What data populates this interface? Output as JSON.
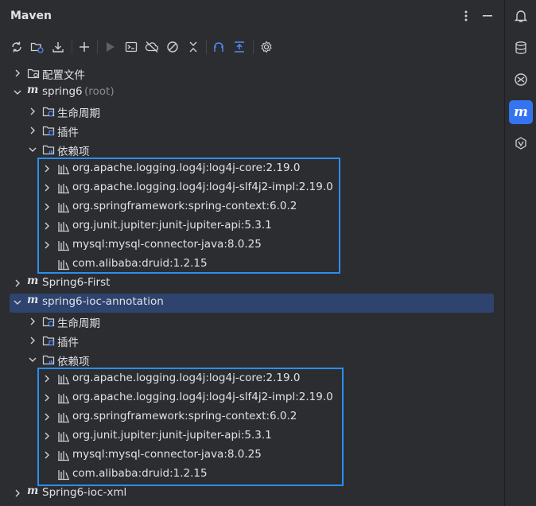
{
  "panel": {
    "title": "Maven"
  },
  "tree": {
    "config_files": "配置文件",
    "spring6": {
      "name": "spring6",
      "suffix": "(root)"
    },
    "lifecycle": "生命周期",
    "plugins": "插件",
    "dependencies": "依赖项",
    "deps_group1": [
      "org.apache.logging.log4j:log4j-core:2.19.0",
      "org.apache.logging.log4j:log4j-slf4j2-impl:2.19.0",
      "org.springframework:spring-context:6.0.2",
      "org.junit.jupiter:junit-jupiter-api:5.3.1",
      "mysql:mysql-connector-java:8.0.25",
      "com.alibaba:druid:1.2.15"
    ],
    "spring6_first": "Spring6-First",
    "spring6_ioc_annotation": "spring6-ioc-annotation",
    "lifecycle2": "生命周期",
    "plugins2": "插件",
    "dependencies2": "依赖项",
    "deps_group2": [
      "org.apache.logging.log4j:log4j-core:2.19.0",
      "org.apache.logging.log4j:log4j-slf4j2-impl:2.19.0",
      "org.springframework:spring-context:6.0.2",
      "org.junit.jupiter:junit-jupiter-api:5.3.1",
      "mysql:mysql-connector-java:8.0.25",
      "com.alibaba:druid:1.2.15"
    ],
    "spring6_ioc_xml": "Spring6-ioc-xml"
  },
  "maven_logo_letter": "m",
  "colors": {
    "accent": "#3574f0",
    "highlight_box": "#2d8ef0",
    "selection": "#2e436e",
    "background": "#2b2d30"
  }
}
